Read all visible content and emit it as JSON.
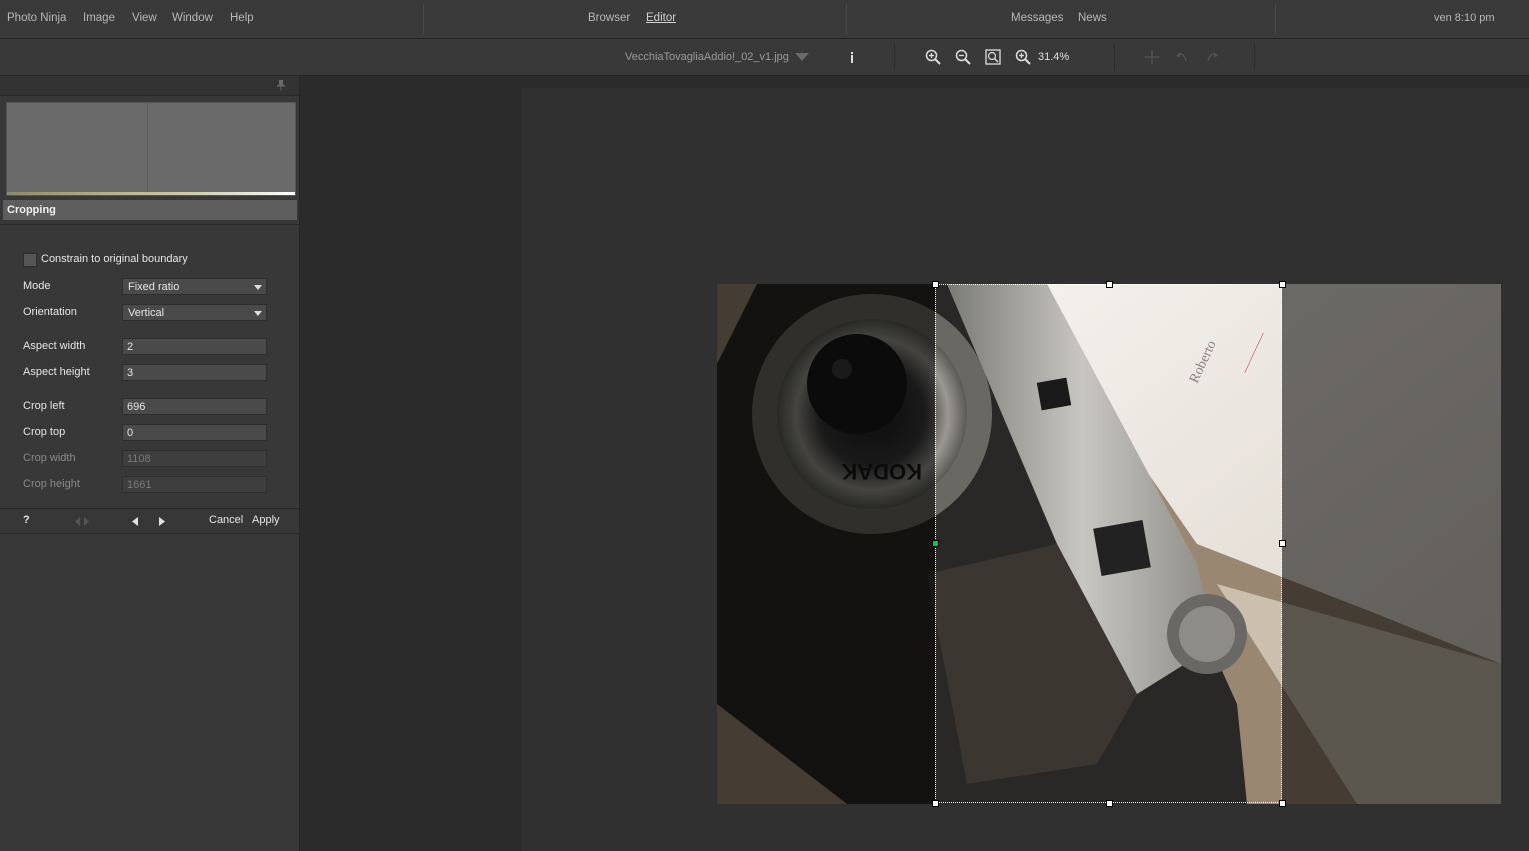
{
  "menubar": {
    "items": [
      "Photo Ninja",
      "Image",
      "View",
      "Window",
      "Help"
    ],
    "center": [
      "Browser",
      "Editor"
    ],
    "right": [
      "Messages",
      "News"
    ],
    "clock": "ven 8:10 pm"
  },
  "toolbar": {
    "filename": "VecchiaTovagliaAddio!_02_v1.jpg",
    "zoom_level": "31.4%",
    "icons": [
      "info-icon",
      "zoom-in-icon",
      "zoom-out-icon",
      "fit-window-icon",
      "zoom-actual-icon",
      "pan-icon",
      "undo-icon",
      "redo-icon"
    ]
  },
  "cropping": {
    "title": "Cropping",
    "constrain_label": "Constrain to original boundary",
    "mode_label": "Mode",
    "mode_value": "Fixed ratio",
    "orientation_label": "Orientation",
    "orientation_value": "Vertical",
    "aspect_width_label": "Aspect width",
    "aspect_width_value": "2",
    "aspect_height_label": "Aspect height",
    "aspect_height_value": "3",
    "crop_left_label": "Crop left",
    "crop_left_value": "696",
    "crop_top_label": "Crop top",
    "crop_top_value": "0",
    "crop_width_label": "Crop width",
    "crop_width_value": "1108",
    "crop_height_label": "Crop height",
    "crop_height_value": "1661"
  },
  "bottom_bar": {
    "help": "?",
    "cancel": "Cancel",
    "apply": "Apply"
  },
  "colors": {
    "accent_handle": "#00cc33",
    "panel_bg": "#383838",
    "canvas_bg": "#2b2b2b"
  }
}
